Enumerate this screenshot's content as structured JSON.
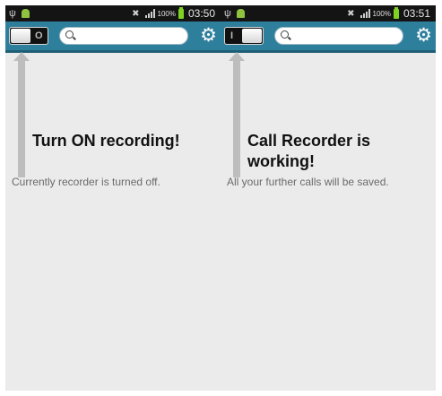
{
  "screens": [
    {
      "status": {
        "battery": "100%",
        "time": "03:50"
      },
      "toggle_state": "off",
      "search": {
        "placeholder": ""
      },
      "headline": "Turn ON recording!",
      "message": "Currently recorder is turned off."
    },
    {
      "status": {
        "battery": "100%",
        "time": "03:51"
      },
      "toggle_state": "on",
      "search": {
        "placeholder": ""
      },
      "headline": "Call Recorder is working!",
      "message": "All your further calls will be saved."
    }
  ],
  "icons": [
    "usb-icon",
    "android-icon",
    "mute-icon",
    "signal-icon",
    "battery-icon",
    "search-icon",
    "gear-icon",
    "arrow-up-icon"
  ],
  "colors": {
    "toolbar": "#2e7f9c",
    "statusbar": "#141414",
    "background": "#ebebeb"
  }
}
